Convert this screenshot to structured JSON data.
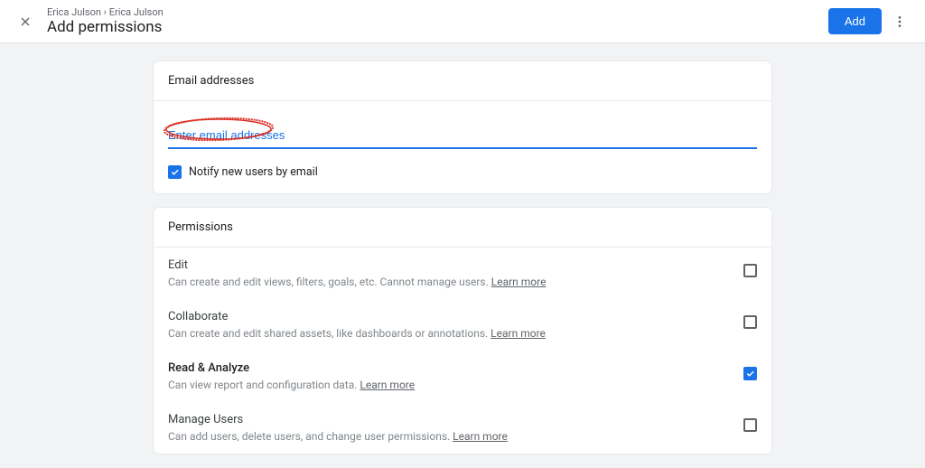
{
  "header": {
    "breadcrumb": "Erica Julson › Erica Julson",
    "title": "Add permissions",
    "add_label": "Add"
  },
  "email_card": {
    "header": "Email addresses",
    "placeholder": "Enter email addresses",
    "notify_label": "Notify new users by email",
    "notify_checked": true
  },
  "permissions_card": {
    "header": "Permissions",
    "learn_more": "Learn more",
    "items": [
      {
        "title": "Edit",
        "desc": "Can create and edit views, filters, goals, etc. Cannot manage users. ",
        "checked": false,
        "strong": false
      },
      {
        "title": "Collaborate",
        "desc": "Can create and edit shared assets, like dashboards or annotations. ",
        "checked": false,
        "strong": false
      },
      {
        "title": "Read & Analyze",
        "desc": "Can view report and configuration data. ",
        "checked": true,
        "strong": true
      },
      {
        "title": "Manage Users",
        "desc": "Can add users, delete users, and change user permissions. ",
        "checked": false,
        "strong": false,
        "divider": true
      }
    ]
  }
}
